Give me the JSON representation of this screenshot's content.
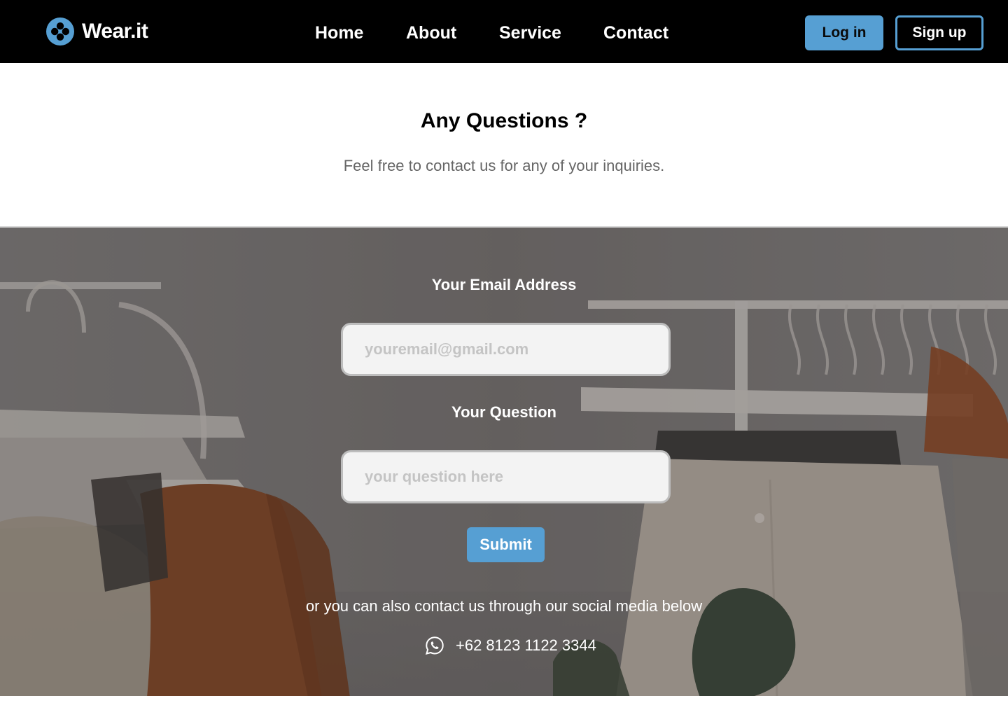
{
  "nav": {
    "brand": {
      "name": "Wear.it",
      "icon": "brand-logo-icon",
      "color": "#569fd3"
    },
    "links": [
      {
        "label": "Home"
      },
      {
        "label": "About"
      },
      {
        "label": "Service"
      },
      {
        "label": "Contact"
      }
    ],
    "login_label": "Log in",
    "signup_label": "Sign up",
    "accent_color": "#569fd3"
  },
  "intro": {
    "title": "Any Questions ?",
    "subtitle": "Feel free to contact us for any of your inquiries."
  },
  "form": {
    "email_label": "Your Email Address",
    "email_placeholder": "youremail@gmail.com",
    "email_value": "",
    "question_label": "Your Question",
    "question_placeholder": "your question here",
    "question_value": "",
    "submit_label": "Submit"
  },
  "social": {
    "note": "or you can also contact us through our social media below",
    "whatsapp_icon": "whatsapp-icon",
    "phone": "+62 8123 1122 3344"
  }
}
